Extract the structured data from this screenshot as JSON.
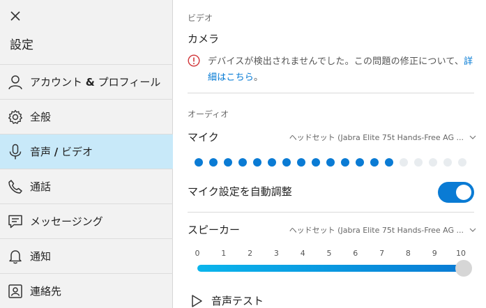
{
  "sidebar": {
    "close_icon": "close-icon",
    "title": "設定",
    "items": [
      {
        "label_pre": "アカウント ",
        "label_bold": "&",
        "label_post": " プロフィール",
        "icon": "person-icon"
      },
      {
        "label_pre": "全般",
        "label_bold": "",
        "label_post": "",
        "icon": "gear-icon"
      },
      {
        "label_pre": "音声 ",
        "label_bold": "/",
        "label_post": " ビデオ",
        "icon": "microphone-icon",
        "active": true
      },
      {
        "label_pre": "通話",
        "label_bold": "",
        "label_post": "",
        "icon": "phone-icon"
      },
      {
        "label_pre": "メッセージング",
        "label_bold": "",
        "label_post": "",
        "icon": "chat-icon"
      },
      {
        "label_pre": "通知",
        "label_bold": "",
        "label_post": "",
        "icon": "bell-icon"
      },
      {
        "label_pre": "連絡先",
        "label_bold": "",
        "label_post": "",
        "icon": "contact-card-icon"
      }
    ]
  },
  "video": {
    "section_label": "ビデオ",
    "camera_label": "カメラ",
    "warning_text": "デバイスが検出されませんでした。この問題の修正について、",
    "warning_link": "詳細はこちら",
    "warning_end": "。"
  },
  "audio": {
    "section_label": "オーディオ",
    "mic_label": "マイク",
    "mic_device": "ヘッドセット (Jabra Elite 75t Hands-Free AG ...",
    "mic_level": {
      "active": 14,
      "total": 19
    },
    "auto_adjust_label": "マイク設定を自動調整",
    "auto_adjust_on": true,
    "speaker_label": "スピーカー",
    "speaker_device": "ヘッドセット (Jabra Elite 75t Hands-Free AG ...",
    "volume_ticks": [
      "0",
      "1",
      "2",
      "3",
      "4",
      "5",
      "6",
      "7",
      "8",
      "9",
      "10"
    ],
    "volume_value": 10,
    "test_label": "音声テスト"
  },
  "colors": {
    "accent": "#0a7bd4",
    "active_nav_bg": "#c8e9f9",
    "warning": "#d13438"
  }
}
